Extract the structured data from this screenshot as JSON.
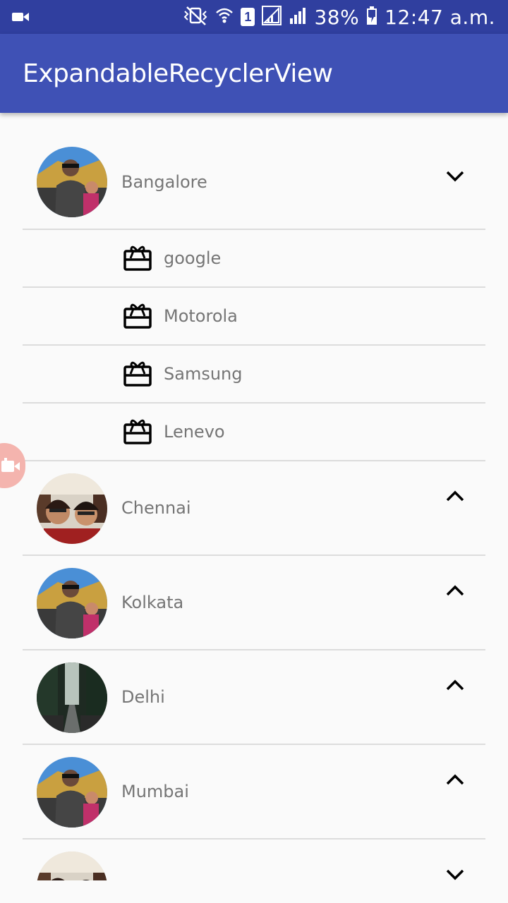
{
  "status_bar": {
    "battery": "38%",
    "time": "12:47 a.m.",
    "sim_slot": "1",
    "icons": [
      "video-camera-icon",
      "vibrate-icon",
      "wifi-icon",
      "sim-slot-icon",
      "signal-icon",
      "signal-icon",
      "battery-charging-icon"
    ]
  },
  "app_bar": {
    "title": "ExpandableRecyclerView"
  },
  "groups": [
    {
      "label": "Bangalore",
      "expanded": true,
      "children": [
        {
          "label": "google",
          "icon": "gift-card-icon"
        },
        {
          "label": "Motorola",
          "icon": "gift-card-icon"
        },
        {
          "label": "Samsung",
          "icon": "gift-card-icon"
        },
        {
          "label": "Lenevo",
          "icon": "gift-card-icon"
        }
      ]
    },
    {
      "label": "Chennai",
      "expanded": false
    },
    {
      "label": "Kolkata",
      "expanded": false
    },
    {
      "label": "Delhi",
      "expanded": false
    },
    {
      "label": "Mumbai",
      "expanded": false
    },
    {
      "label": "",
      "expanded": true
    }
  ],
  "colors": {
    "status_bar": "#303f9f",
    "app_bar": "#3f51b5",
    "background": "#fafafa",
    "text_secondary": "#757575",
    "divider": "#dcdcdc",
    "floating_button": "#f4b4ae"
  }
}
